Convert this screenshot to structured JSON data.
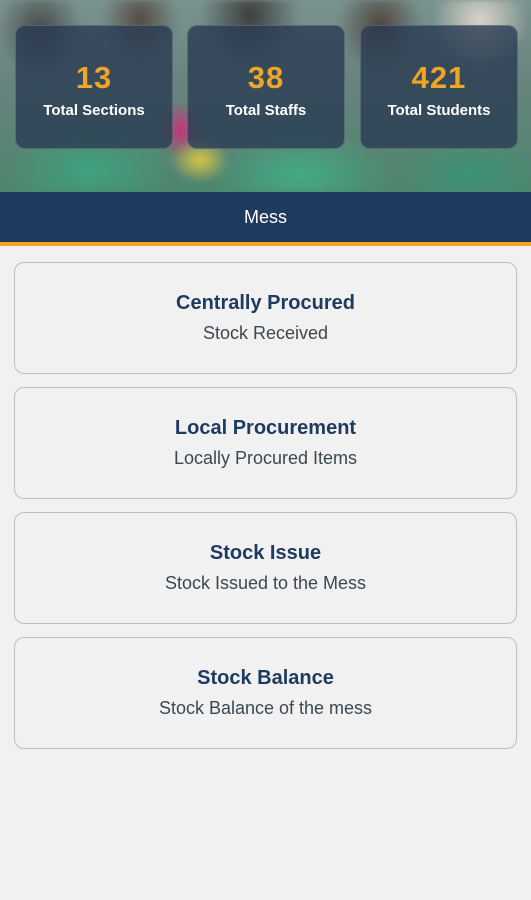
{
  "stats": [
    {
      "value": "13",
      "label": "Total Sections"
    },
    {
      "value": "38",
      "label": "Total Staffs"
    },
    {
      "value": "421",
      "label": "Total Students"
    }
  ],
  "header": {
    "title": "Mess"
  },
  "menu": [
    {
      "title": "Centrally Procured",
      "subtitle": "Stock Received"
    },
    {
      "title": "Local Procurement",
      "subtitle": "Locally Procured Items"
    },
    {
      "title": "Stock Issue",
      "subtitle": "Stock Issued to the Mess"
    },
    {
      "title": "Stock Balance",
      "subtitle": "Stock Balance of the mess"
    }
  ],
  "colors": {
    "primary": "#1e3a5f",
    "accent": "#f0a526",
    "background": "#f1f1f1"
  }
}
